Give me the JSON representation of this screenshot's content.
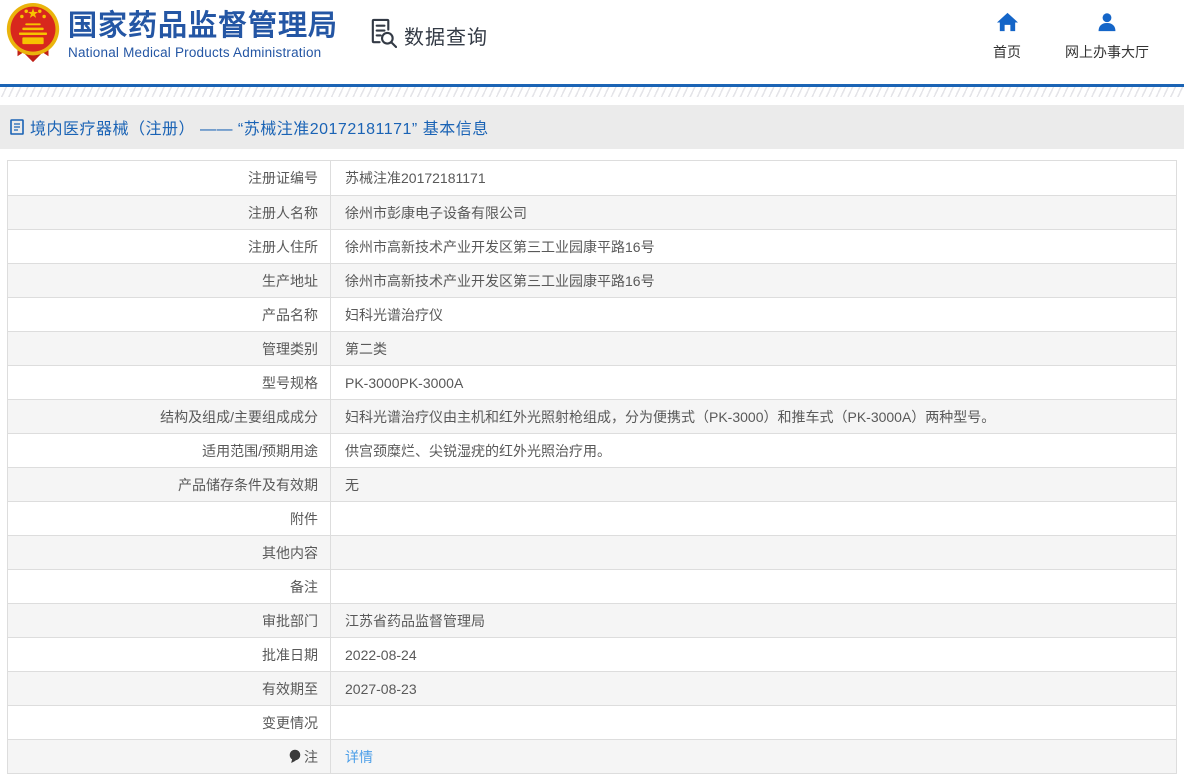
{
  "header": {
    "emblem": "china-national-emblem",
    "agency_name_cn": "国家药品监督管理局",
    "agency_name_en": "National Medical Products Administration",
    "section_title": "数据查询",
    "quick_links": [
      {
        "label": "首页",
        "icon": "home-icon"
      },
      {
        "label": "网上办事大厅",
        "icon": "person-icon"
      }
    ]
  },
  "breadcrumb": {
    "icon": "document-icon",
    "text": "境内医疗器械（注册） —— “苏械注准20172181171” 基本信息"
  },
  "detail_table": {
    "rows": [
      {
        "label": "注册证编号",
        "value": "苏械注准20172181171"
      },
      {
        "label": "注册人名称",
        "value": "徐州市彭康电子设备有限公司"
      },
      {
        "label": "注册人住所",
        "value": "徐州市高新技术产业开发区第三工业园康平路16号"
      },
      {
        "label": "生产地址",
        "value": "徐州市高新技术产业开发区第三工业园康平路16号"
      },
      {
        "label": "产品名称",
        "value": "妇科光谱治疗仪"
      },
      {
        "label": "管理类别",
        "value": "第二类"
      },
      {
        "label": "型号规格",
        "value": "PK-3000PK-3000A"
      },
      {
        "label": "结构及组成/主要组成成分",
        "value": "妇科光谱治疗仪由主机和红外光照射枪组成，分为便携式（PK-3000）和推车式（PK-3000A）两种型号。"
      },
      {
        "label": "适用范围/预期用途",
        "value": "供宫颈糜烂、尖锐湿疣的红外光照治疗用。"
      },
      {
        "label": "产品储存条件及有效期",
        "value": "无"
      },
      {
        "label": "附件",
        "value": ""
      },
      {
        "label": "其他内容",
        "value": ""
      },
      {
        "label": "备注",
        "value": ""
      },
      {
        "label": "审批部门",
        "value": "江苏省药品监督管理局"
      },
      {
        "label": "批准日期",
        "value": "2022-08-24"
      },
      {
        "label": "有效期至",
        "value": "2027-08-23"
      },
      {
        "label": "变更情况",
        "value": ""
      },
      {
        "label": "注",
        "value": "详情",
        "link": true,
        "label_icon": "bulb-icon"
      }
    ]
  },
  "colors": {
    "brand_blue": "#2456a4",
    "divider_blue": "#1b64b5",
    "icon_blue": "#1465c8",
    "link_blue": "#4d9fe8",
    "crumb_bar_gray": "#ebebeb",
    "row_alt_gray": "#f5f5f5",
    "border_gray": "#dddddd",
    "text_gray": "#595959"
  }
}
